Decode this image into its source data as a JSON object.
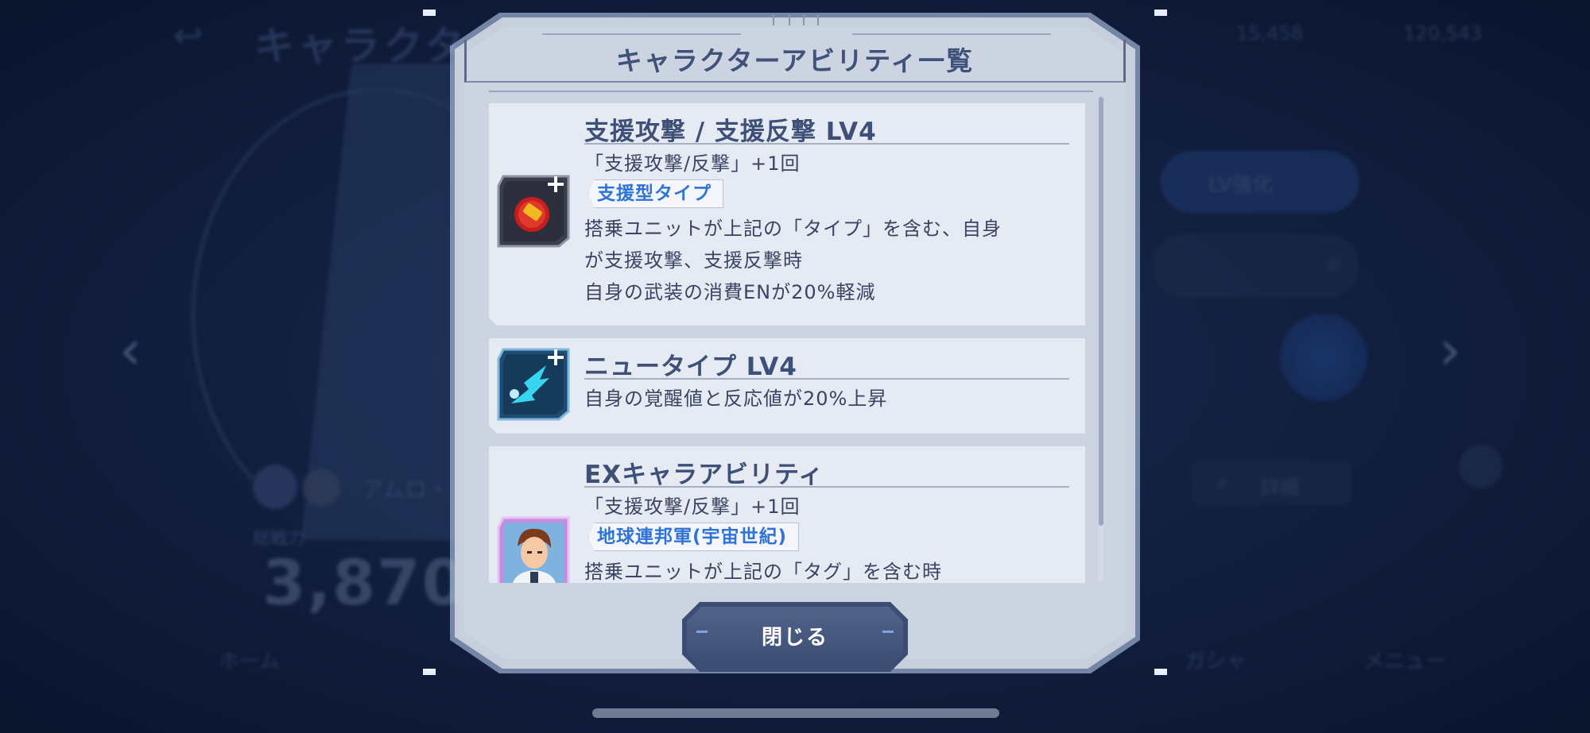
{
  "modal": {
    "title": "キャラクターアビリティ一覧",
    "close_label": "閉じる"
  },
  "abilities": [
    {
      "title": "支援攻撃 / 支援反撃 LV4",
      "line1": "「支援攻撃/反撃」+1回",
      "tag": "支援型タイプ",
      "desc1": "搭乗ユニットが上記の「タイプ」を含む、自身",
      "desc2": "が支援攻撃、支援反撃時",
      "desc3": "自身の武装の消費ENが20%軽減",
      "icon": "support-attack-icon"
    },
    {
      "title": "ニュータイプ LV4",
      "line1": "自身の覚醒値と反応値が20%上昇",
      "icon": "newtype-icon"
    },
    {
      "title": "EXキャラアビリティ",
      "line1": "「支援攻撃/反撃」+1回",
      "tag": "地球連邦軍(宇宙世紀)",
      "desc1": "搭乗ユニットが上記の「タグ」を含む時",
      "icon": "character-portrait"
    }
  ],
  "background": {
    "title": "キャラクタ",
    "power_label": "総戦力",
    "power_value": "3,870",
    "pilot_name": "アムロ・",
    "lv_button": "LV強化",
    "detail_button": "詳細",
    "nav_home": "ホーム",
    "nav_gacha": "ガシャ",
    "nav_menu": "メニュー",
    "currency1": "15,458",
    "currency2": "120,543"
  },
  "colors": {
    "accent_blue": "#2e74d6",
    "title_text": "#41527a",
    "card_bg": "#e6eaf2"
  }
}
